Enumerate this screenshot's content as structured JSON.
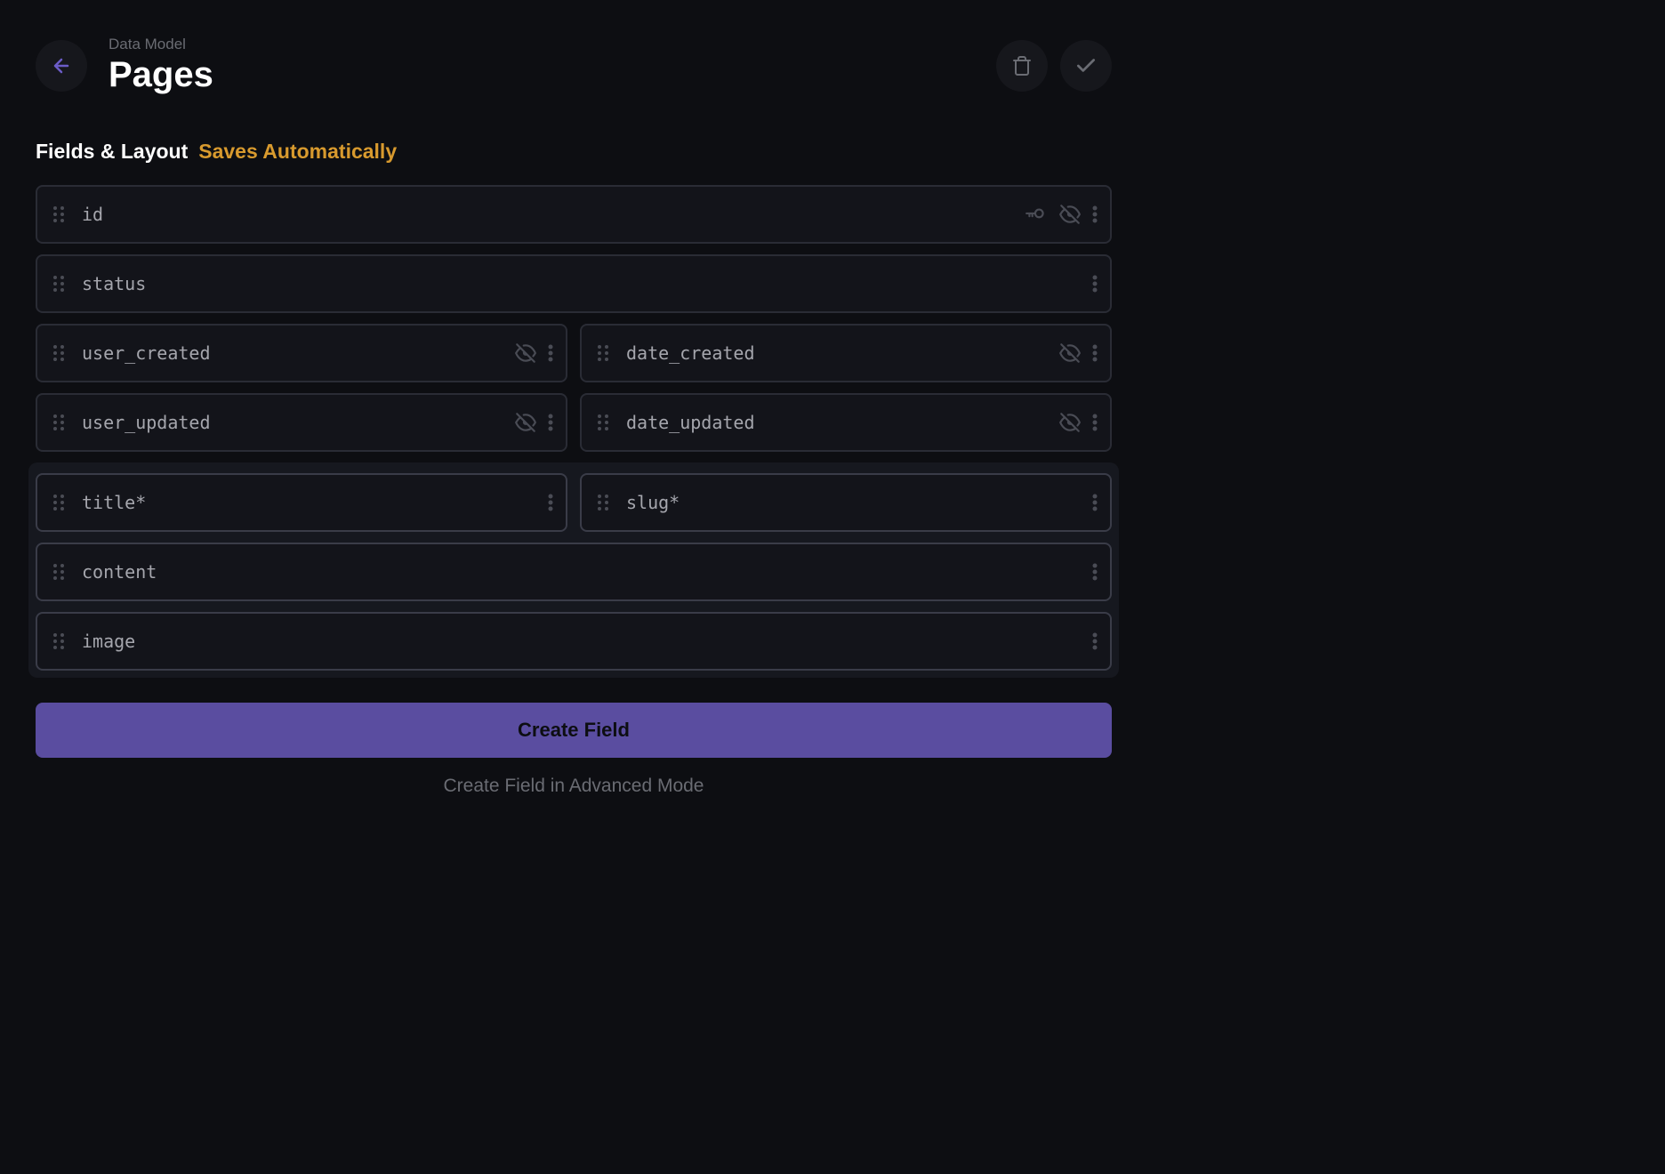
{
  "header": {
    "breadcrumb": "Data Model",
    "title": "Pages"
  },
  "section": {
    "title": "Fields & Layout",
    "subtitle": "Saves Automatically"
  },
  "fields": {
    "id": {
      "name": "id"
    },
    "status": {
      "name": "status"
    },
    "user_created": {
      "name": "user_created"
    },
    "date_created": {
      "name": "date_created"
    },
    "user_updated": {
      "name": "user_updated"
    },
    "date_updated": {
      "name": "date_updated"
    },
    "title": {
      "name": "title",
      "required": "*"
    },
    "slug": {
      "name": "slug",
      "required": "*"
    },
    "content": {
      "name": "content"
    },
    "image": {
      "name": "image"
    }
  },
  "actions": {
    "create_field": "Create Field",
    "advanced_mode": "Create Field in Advanced Mode"
  }
}
